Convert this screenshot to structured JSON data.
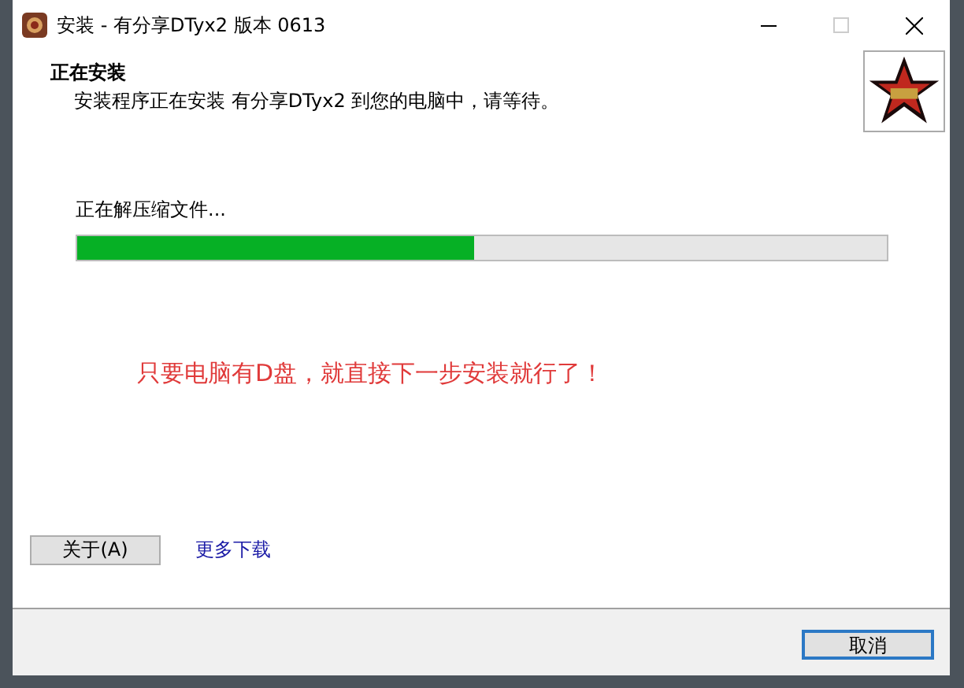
{
  "window": {
    "title": "安装 - 有分享DTyx2 版本 0613"
  },
  "header": {
    "title": "正在安装",
    "subtitle": "安装程序正在安装 有分享DTyx2 到您的电脑中，请等待。"
  },
  "status": "正在解压缩文件...",
  "progress": {
    "level": 0.49
  },
  "notice": "只要电脑有D盘，就直接下一步安装就行了！",
  "about_button": "关于(A)",
  "more_link": "更多下载",
  "cancel_button": "取消",
  "controls": {
    "maximize_disabled": true
  }
}
